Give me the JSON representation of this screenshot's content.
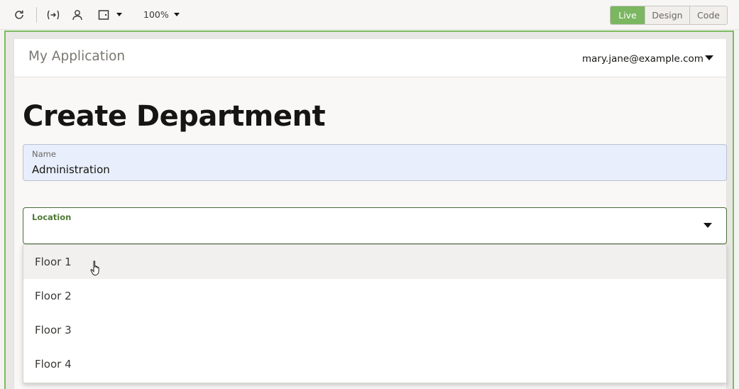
{
  "toolbar": {
    "icons": [
      "refresh-icon",
      "variables-icon",
      "user-icon",
      "device-icon"
    ],
    "zoom": "100%",
    "modes": [
      "Live",
      "Design",
      "Code"
    ],
    "active_mode": "Live",
    "accent": "#7bb661"
  },
  "app": {
    "title": "My Application",
    "user": "mary.jane@example.com"
  },
  "page": {
    "title": "Create Department"
  },
  "form": {
    "name_label": "Name",
    "name_value": "Administration",
    "location_label": "Location",
    "location_value": ""
  },
  "dropdown": {
    "options": [
      "Floor 1",
      "Floor 2",
      "Floor 3",
      "Floor 4"
    ],
    "hovered_index": 0
  }
}
